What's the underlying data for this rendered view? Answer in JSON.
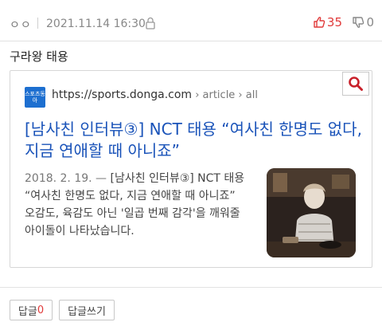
{
  "post": {
    "author": "ㅇㅇ",
    "datetime": "2021.11.14 16:30",
    "upvotes": "35",
    "downvotes": "0",
    "body": "구라왕 태용"
  },
  "link_card": {
    "site_logo": "스포츠동아",
    "url_domain": "https://sports.donga.com",
    "url_path": " › article › all",
    "headline": "[남사친 인터뷰③] NCT 태용 “여사친 한명도 없다, 지금 연애할 때 아니죠”",
    "snippet_date": "2018. 2. 19. — ",
    "snippet": "[남사친 인터뷰③] NCT 태용 “여사친 한명도 없다, 지금 연애할 때 아니죠” 오감도, 육감도 아닌 '일곱 번째 감각'을 깨워줄 아이돌이 나타났습니다."
  },
  "footer": {
    "reply_label": "답글",
    "reply_count": "0",
    "write_reply_label": "답글쓰기"
  },
  "colors": {
    "accent_red": "#e03a3a",
    "link_blue": "#1a53b9",
    "search_red": "#c8202a"
  }
}
